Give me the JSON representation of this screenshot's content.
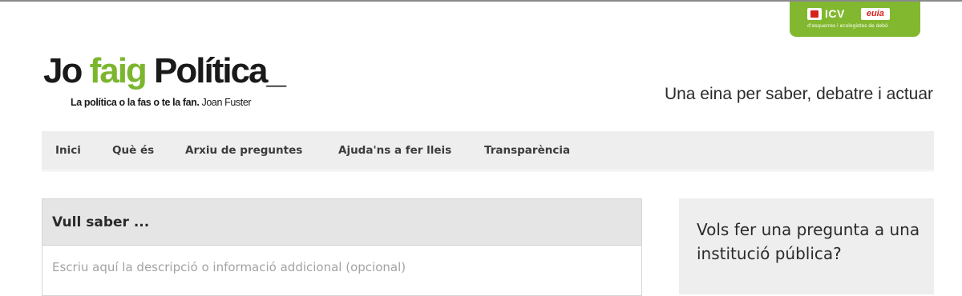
{
  "party": {
    "name": "ICV",
    "secondary": "euia",
    "tagline": "d'esquerres i ecologistes de debò",
    "color": "#82b82f",
    "accent": "#d6231f"
  },
  "logo": {
    "part1": "Jo ",
    "part2": "faig",
    "part3": " Política_",
    "tagline_bold": "La política o la fas o te la fan.",
    "tagline_author": " Joan Fuster",
    "green": "#7cb62f"
  },
  "header": {
    "tagline": "Una eina per saber, debatre i actuar"
  },
  "nav": {
    "items": [
      {
        "label": "Inici"
      },
      {
        "label": "Què és"
      },
      {
        "label": "Arxiu de preguntes"
      },
      {
        "label": "Ajuda'ns a fer lleis"
      },
      {
        "label": "Transparència"
      }
    ]
  },
  "question": {
    "title": "Vull saber  ...",
    "description_placeholder": "Escriu aquí la descripció o informació addicional (opcional)"
  },
  "sidebar": {
    "text": "Vols fer una pregunta a una institució pública?"
  }
}
